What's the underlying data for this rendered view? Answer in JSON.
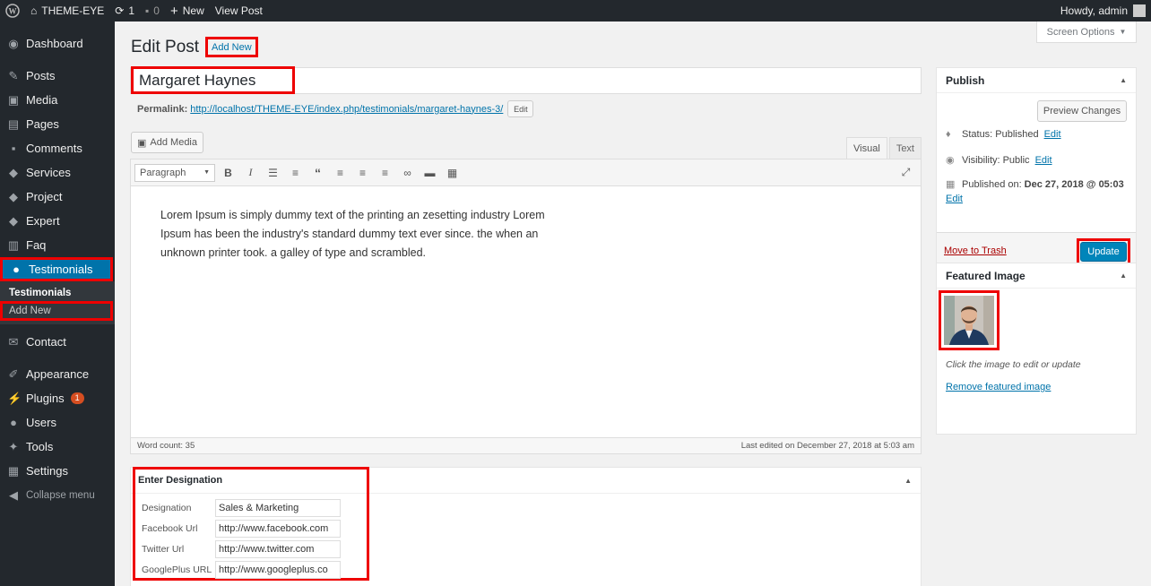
{
  "adminbar": {
    "site": "THEME-EYE",
    "updates": "1",
    "comments": "0",
    "new": "New",
    "view_post": "View Post",
    "howdy": "Howdy, admin"
  },
  "sidebar": {
    "items": [
      {
        "label": "Dashboard",
        "icon": "dashboard-icon"
      },
      {
        "label": "Posts",
        "icon": "pin-icon"
      },
      {
        "label": "Media",
        "icon": "media-icon"
      },
      {
        "label": "Pages",
        "icon": "pages-icon"
      },
      {
        "label": "Comments",
        "icon": "comments-icon"
      },
      {
        "label": "Services",
        "icon": "tag-icon"
      },
      {
        "label": "Project",
        "icon": "tag-icon"
      },
      {
        "label": "Expert",
        "icon": "tag-icon"
      },
      {
        "label": "Faq",
        "icon": "document-icon"
      },
      {
        "label": "Testimonials",
        "icon": "user-icon"
      },
      {
        "label": "Contact",
        "icon": "mail-icon"
      },
      {
        "label": "Appearance",
        "icon": "brush-icon"
      },
      {
        "label": "Plugins",
        "icon": "plug-icon"
      },
      {
        "label": "Users",
        "icon": "users-icon"
      },
      {
        "label": "Tools",
        "icon": "wrench-icon"
      },
      {
        "label": "Settings",
        "icon": "settings-icon"
      },
      {
        "label": "Collapse menu",
        "icon": "collapse-icon"
      }
    ],
    "sub_current": "Testimonials",
    "sub_add": "Add New",
    "plugins_badge": "1"
  },
  "page": {
    "heading": "Edit Post",
    "add_new": "Add New",
    "screen_options": "Screen Options",
    "title_value": "Margaret Haynes",
    "permalink_label": "Permalink:",
    "permalink_url": "http://localhost/THEME-EYE/index.php/testimonials/margaret-haynes-3/",
    "permalink_edit": "Edit"
  },
  "editor": {
    "add_media": "Add Media",
    "tab_visual": "Visual",
    "tab_text": "Text",
    "format": "Paragraph",
    "content": "Lorem Ipsum is simply dummy text of the printing an zesetting industry Lorem Ipsum has been the industry's standard dummy text ever since. the when an unknown printer took. a galley of type and scrambled.",
    "word_count": "Word count: 35",
    "last_edited": "Last edited on December 27, 2018 at 5:03 am"
  },
  "designation": {
    "title": "Enter Designation",
    "fields": [
      {
        "label": "Designation",
        "value": "Sales & Marketing"
      },
      {
        "label": "Facebook Url",
        "value": "http://www.facebook.com"
      },
      {
        "label": "Twitter Url",
        "value": "http://www.twitter.com"
      },
      {
        "label": "GooglePlus URL",
        "value": "http://www.googleplus.co"
      }
    ]
  },
  "publish": {
    "title": "Publish",
    "preview": "Preview Changes",
    "status_label": "Status:",
    "status_value": "Published",
    "visibility_label": "Visibility:",
    "visibility_value": "Public",
    "published_label": "Published on:",
    "published_value": "Dec 27, 2018 @ 05:03",
    "edit": "Edit",
    "trash": "Move to Trash",
    "update": "Update"
  },
  "featured": {
    "title": "Featured Image",
    "hint": "Click the image to edit or update",
    "remove": "Remove featured image"
  },
  "colors": {
    "accent": "#0073aa",
    "highlight": "#ee0000",
    "sidebar": "#23282d"
  }
}
